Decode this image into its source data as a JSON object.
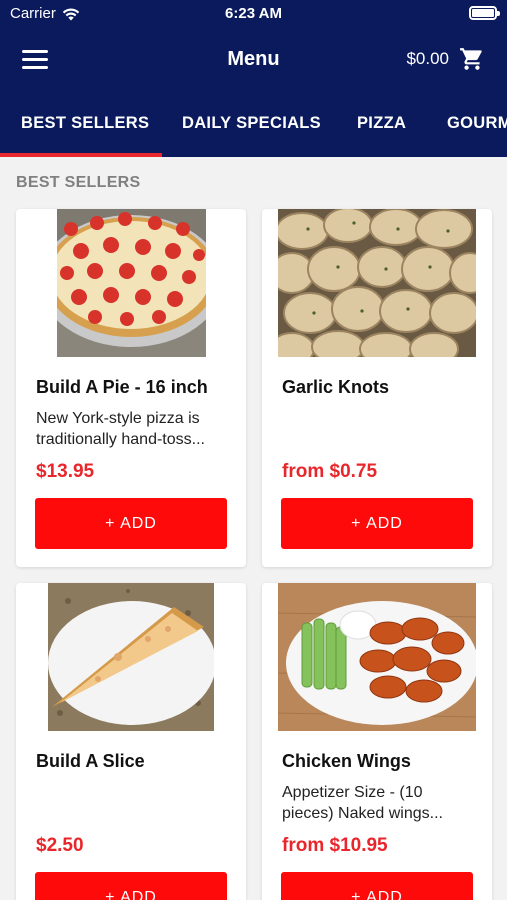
{
  "status_bar": {
    "carrier": "Carrier",
    "time": "6:23 AM"
  },
  "navbar": {
    "title": "Menu",
    "cart_total": "$0.00"
  },
  "tabs": [
    {
      "label": "BEST SELLERS",
      "active": true
    },
    {
      "label": "DAILY SPECIALS",
      "active": false
    },
    {
      "label": "PIZZA",
      "active": false
    },
    {
      "label": "GOURMET",
      "active": false
    }
  ],
  "section_title": "BEST SELLERS",
  "products": [
    {
      "name": "Build A Pie - 16 inch",
      "description": "New York-style pizza is traditionally hand-toss...",
      "price": "$13.95",
      "add_label": "+ ADD"
    },
    {
      "name": "Garlic Knots",
      "description": "",
      "price": "from $0.75",
      "add_label": "+ ADD"
    },
    {
      "name": "Build A Slice",
      "description": "",
      "price": "$2.50",
      "add_label": "+ ADD"
    },
    {
      "name": "Chicken Wings",
      "description": "Appetizer Size - (10 pieces) Naked wings...",
      "price": "from $10.95",
      "add_label": "+ ADD"
    }
  ],
  "colors": {
    "header_bg": "#0a1a5c",
    "accent_red": "#e8262b",
    "button_red": "#ff0a0a",
    "section_gray": "#808080"
  },
  "icons": {
    "menu": "hamburger-icon",
    "cart": "cart-icon",
    "wifi": "wifi-icon",
    "battery": "battery-icon"
  }
}
